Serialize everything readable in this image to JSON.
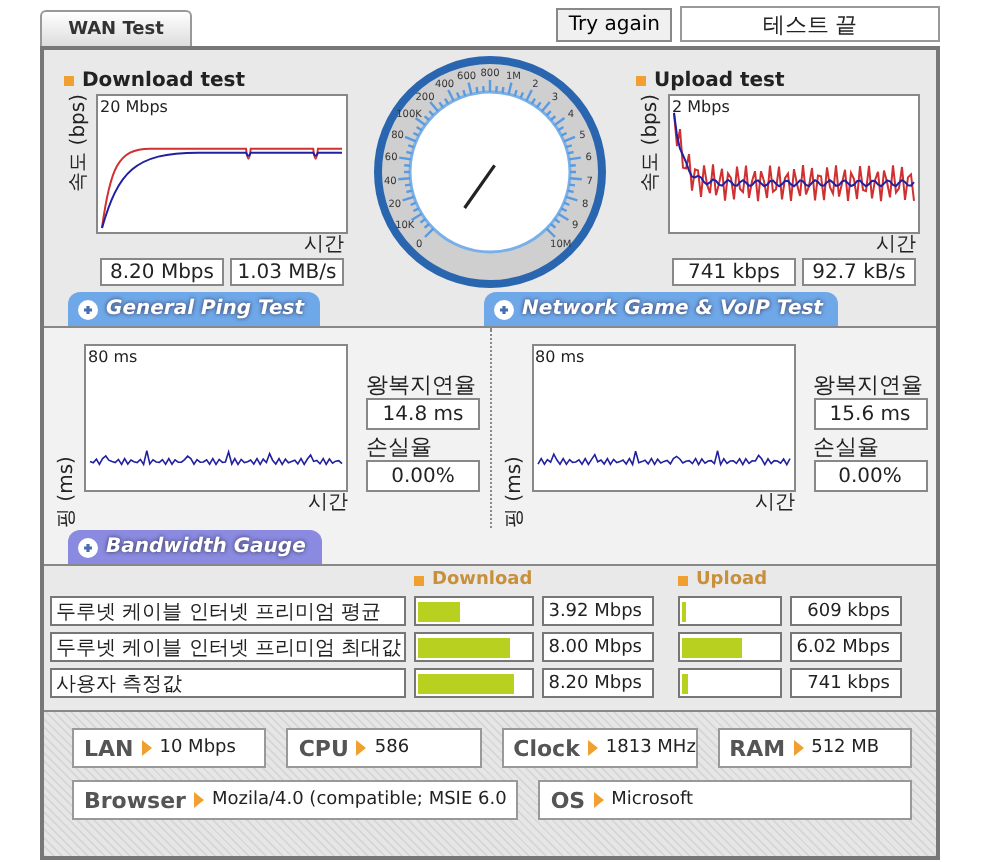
{
  "top": {
    "tabs": [
      {
        "label": "WAN Test",
        "selected": true
      }
    ],
    "retry_button": "Try again",
    "status": "테스트 끝"
  },
  "speed": {
    "tests": [
      {
        "title": "Download test",
        "ylabel": "속도 (bps)",
        "scale": "20 Mbps",
        "xlabel": "시간",
        "rate": "8.20 Mbps",
        "throughput": "1.03 MB/s",
        "kind": "download"
      },
      {
        "title": "Upload test",
        "ylabel": "속도 (bps)",
        "scale": "2 Mbps",
        "xlabel": "시간",
        "rate": "741 kbps",
        "throughput": "92.7 kB/s",
        "kind": "upload"
      }
    ],
    "gauge": {
      "labels": [
        "0",
        "10K",
        "20",
        "40",
        "60",
        "80",
        "100K",
        "200",
        "400",
        "600",
        "800",
        "1M",
        "2",
        "3",
        "4",
        "5",
        "6",
        "7",
        "8",
        "9",
        "10M"
      ]
    }
  },
  "section_tabs": [
    {
      "label": "General Ping Test",
      "color": "#6fa8e8"
    },
    {
      "label": "Network Game & VoIP Test",
      "color": "#6fa8e8"
    }
  ],
  "ping": [
    {
      "ylabel": "핑 (ms)",
      "scale": "80 ms",
      "xlabel": "시간",
      "latency_label": "왕복지연율",
      "latency": "14.8 ms",
      "loss_label": "손실율",
      "loss": "0.00%"
    },
    {
      "ylabel": "핑 (ms)",
      "scale": "80 ms",
      "xlabel": "시간",
      "latency_label": "왕복지연율",
      "latency": "15.6 ms",
      "loss_label": "손실율",
      "loss": "0.00%"
    }
  ],
  "bandwidth": {
    "tab": {
      "label": "Bandwidth Gauge",
      "color": "#8a8ae0"
    },
    "columns": [
      "Download",
      "Upload"
    ],
    "rows": [
      {
        "label": "두루넷 케이블 인터넷 프리미엄 평균",
        "download": {
          "level": 0.37,
          "value": "3.92 Mbps"
        },
        "upload": {
          "level": 0.05,
          "value": "609 kbps"
        }
      },
      {
        "label": "두루넷 케이블 인터넷 프리미엄 최대값",
        "download": {
          "level": 0.82,
          "value": "8.00 Mbps"
        },
        "upload": {
          "level": 0.62,
          "value": "6.02 Mbps"
        }
      },
      {
        "label": "사용자 측정값",
        "download": {
          "level": 0.85,
          "value": "8.20 Mbps"
        },
        "upload": {
          "level": 0.06,
          "value": "741 kbps"
        }
      }
    ]
  },
  "system": [
    [
      {
        "label": "LAN",
        "value": "10 Mbps"
      },
      {
        "label": "CPU",
        "value": "586"
      },
      {
        "label": "Clock",
        "value": "1813 MHz"
      },
      {
        "label": "RAM",
        "value": "512 MB"
      }
    ],
    [
      {
        "label": "Browser",
        "value": "Mozila/4.0 (compatible; MSIE 6.0"
      },
      {
        "label": "OS",
        "value": "Microsoft"
      }
    ]
  ]
}
